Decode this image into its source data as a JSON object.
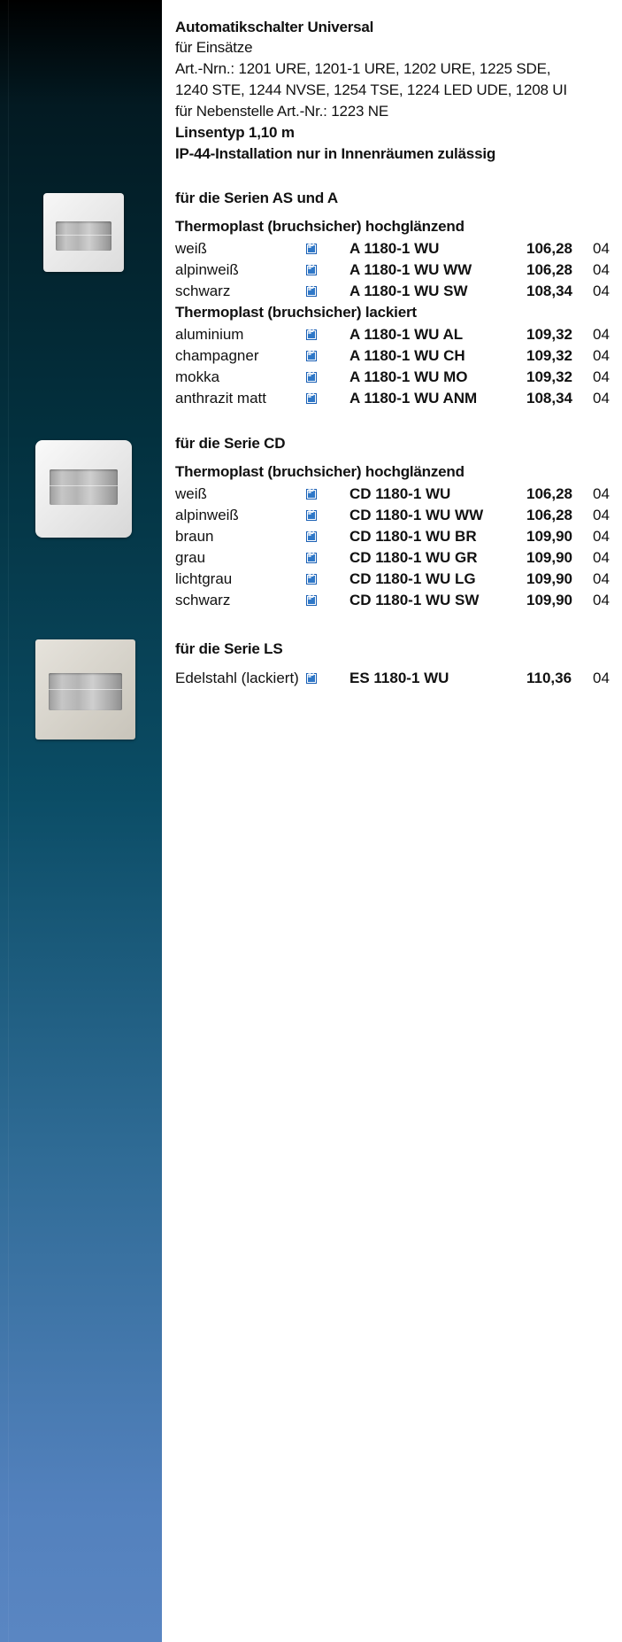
{
  "header": {
    "title": "Automatikschalter Universal",
    "for_inserts": "für Einsätze",
    "art_nrs_line1": " Art.-Nrn.: 1201 URE, 1201-1 URE, 1202 URE, 1225 SDE,",
    "art_nrs_line2": "1240 STE, 1244 NVSE, 1254 TSE, 1224 LED UDE, 1208 UI",
    "extension": "für Nebenstelle Art.-Nr.: 1223 NE",
    "lens_type": "Linsentyp 1,10 m",
    "ip_note": "IP-44-Installation nur in Innenräumen zulässig"
  },
  "ip_icon": {
    "name": "ip-icon",
    "label": "IP",
    "color": "#2f78c8"
  },
  "sections": [
    {
      "heading": "für die Serien AS und A",
      "groups": [
        {
          "material": "Thermoplast (bruchsicher) hochglänzend",
          "rows": [
            {
              "color": "weiß",
              "article": "A 1180-1 WU",
              "price": "106,28",
              "group": "04"
            },
            {
              "color": "alpinweiß",
              "article": "A 1180-1 WU WW",
              "price": "106,28",
              "group": "04"
            },
            {
              "color": "schwarz",
              "article": "A 1180-1 WU SW",
              "price": "108,34",
              "group": "04"
            }
          ]
        },
        {
          "material": "Thermoplast (bruchsicher) lackiert",
          "rows": [
            {
              "color": "aluminium",
              "article": "A 1180-1 WU AL",
              "price": "109,32",
              "group": "04"
            },
            {
              "color": "champagner",
              "article": "A 1180-1 WU CH",
              "price": "109,32",
              "group": "04"
            },
            {
              "color": "mokka",
              "article": "A 1180-1 WU MO",
              "price": "109,32",
              "group": "04"
            },
            {
              "color": "anthrazit matt",
              "article": "A 1180-1 WU ANM",
              "price": "108,34",
              "group": "04"
            }
          ]
        }
      ]
    },
    {
      "heading": "für die Serie CD",
      "groups": [
        {
          "material": "Thermoplast (bruchsicher) hochglänzend",
          "rows": [
            {
              "color": "weiß",
              "article": "CD 1180-1 WU",
              "price": "106,28",
              "group": "04"
            },
            {
              "color": "alpinweiß",
              "article": "CD 1180-1 WU WW",
              "price": "106,28",
              "group": "04"
            },
            {
              "color": "braun",
              "article": "CD 1180-1 WU BR",
              "price": "109,90",
              "group": "04"
            },
            {
              "color": "grau",
              "article": "CD 1180-1 WU GR",
              "price": "109,90",
              "group": "04"
            },
            {
              "color": "lichtgrau",
              "article": "CD 1180-1 WU LG",
              "price": "109,90",
              "group": "04"
            },
            {
              "color": "schwarz",
              "article": "CD 1180-1 WU SW",
              "price": "109,90",
              "group": "04"
            }
          ]
        }
      ]
    },
    {
      "heading": "für die Serie LS",
      "groups": [
        {
          "material": "",
          "rows": [
            {
              "color": "Edelstahl (lackiert)",
              "article": "ES 1180-1 WU",
              "price": "110,36",
              "group": "04"
            }
          ]
        }
      ]
    }
  ],
  "colors": {
    "sidebar_top": "#000000",
    "sidebar_bottom": "#5a86c2",
    "ip_blue": "#2f78c8"
  }
}
